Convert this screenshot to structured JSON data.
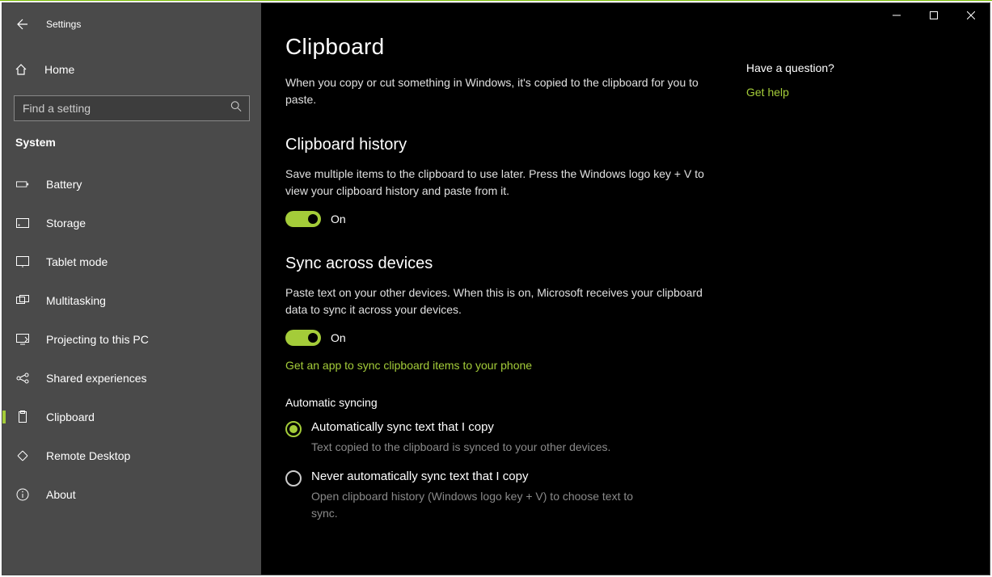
{
  "window": {
    "title": "Settings"
  },
  "sidebar": {
    "home": "Home",
    "search_placeholder": "Find a setting",
    "category": "System",
    "items": [
      {
        "id": "battery",
        "label": "Battery"
      },
      {
        "id": "storage",
        "label": "Storage"
      },
      {
        "id": "tablet-mode",
        "label": "Tablet mode"
      },
      {
        "id": "multitasking",
        "label": "Multitasking"
      },
      {
        "id": "projecting",
        "label": "Projecting to this PC"
      },
      {
        "id": "shared-exp",
        "label": "Shared experiences"
      },
      {
        "id": "clipboard",
        "label": "Clipboard"
      },
      {
        "id": "remote-desktop",
        "label": "Remote Desktop"
      },
      {
        "id": "about",
        "label": "About"
      }
    ]
  },
  "page": {
    "title": "Clipboard",
    "intro": "When you copy or cut something in Windows, it's copied to the clipboard for you to paste.",
    "history": {
      "heading": "Clipboard history",
      "desc": "Save multiple items to the clipboard to use later. Press the Windows logo key + V to view your clipboard history and paste from it.",
      "state_label": "On"
    },
    "sync": {
      "heading": "Sync across devices",
      "desc": "Paste text on your other devices. When this is on, Microsoft receives your clipboard data to sync it across your devices.",
      "state_label": "On",
      "phone_link": "Get an app to sync clipboard items to your phone",
      "auto_heading": "Automatic syncing",
      "radio1_label": "Automatically sync text that I copy",
      "radio1_hint": "Text copied to the clipboard is synced to your other devices.",
      "radio2_label": "Never automatically sync text that I copy",
      "radio2_hint": "Open clipboard history (Windows logo key + V) to choose text to sync."
    }
  },
  "aside": {
    "heading": "Have a question?",
    "link": "Get help"
  }
}
